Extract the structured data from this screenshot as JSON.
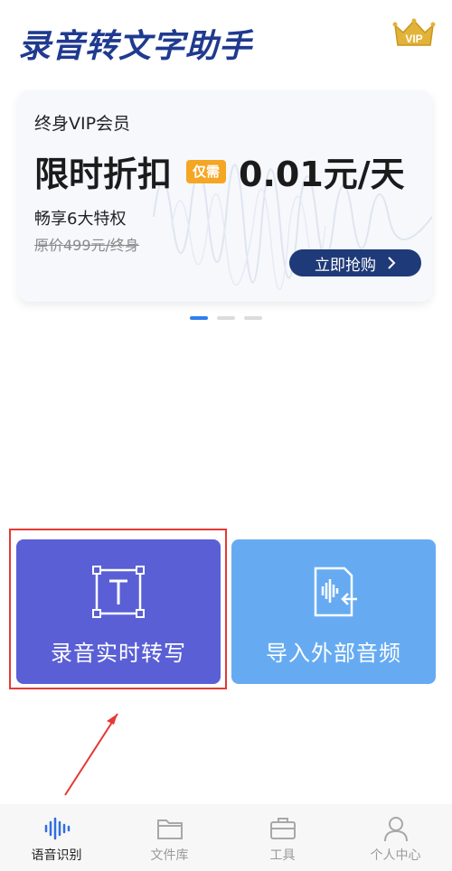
{
  "app": {
    "title": "录音转文字助手",
    "vip_badge": "VIP"
  },
  "promo": {
    "subtitle": "终身VIP会员",
    "headline": "限时折扣",
    "badge": "仅需",
    "price": "0.01元/天",
    "perks": "畅享6大特权",
    "original_price": "原价499元/终身",
    "cta_label": "立即抢购",
    "cta_icon": "chevron-right-icon"
  },
  "pager": {
    "total": 3,
    "active_index": 0
  },
  "actions": {
    "record": {
      "label": "录音实时转写",
      "icon": "text-frame-icon"
    },
    "import": {
      "label": "导入外部音频",
      "icon": "audio-file-import-icon"
    }
  },
  "tabbar": {
    "items": [
      {
        "label": "语音识别",
        "icon": "voice-wave-icon",
        "active": true
      },
      {
        "label": "文件库",
        "icon": "folder-icon",
        "active": false
      },
      {
        "label": "工具",
        "icon": "toolbox-icon",
        "active": false
      },
      {
        "label": "个人中心",
        "icon": "person-icon",
        "active": false
      }
    ]
  },
  "colors": {
    "title": "#1f3a8f",
    "record_button": "#5a5fd6",
    "import_button": "#66abf2",
    "cta": "#1f3a78",
    "badge": "#f5a623",
    "highlight": "#e53935"
  }
}
